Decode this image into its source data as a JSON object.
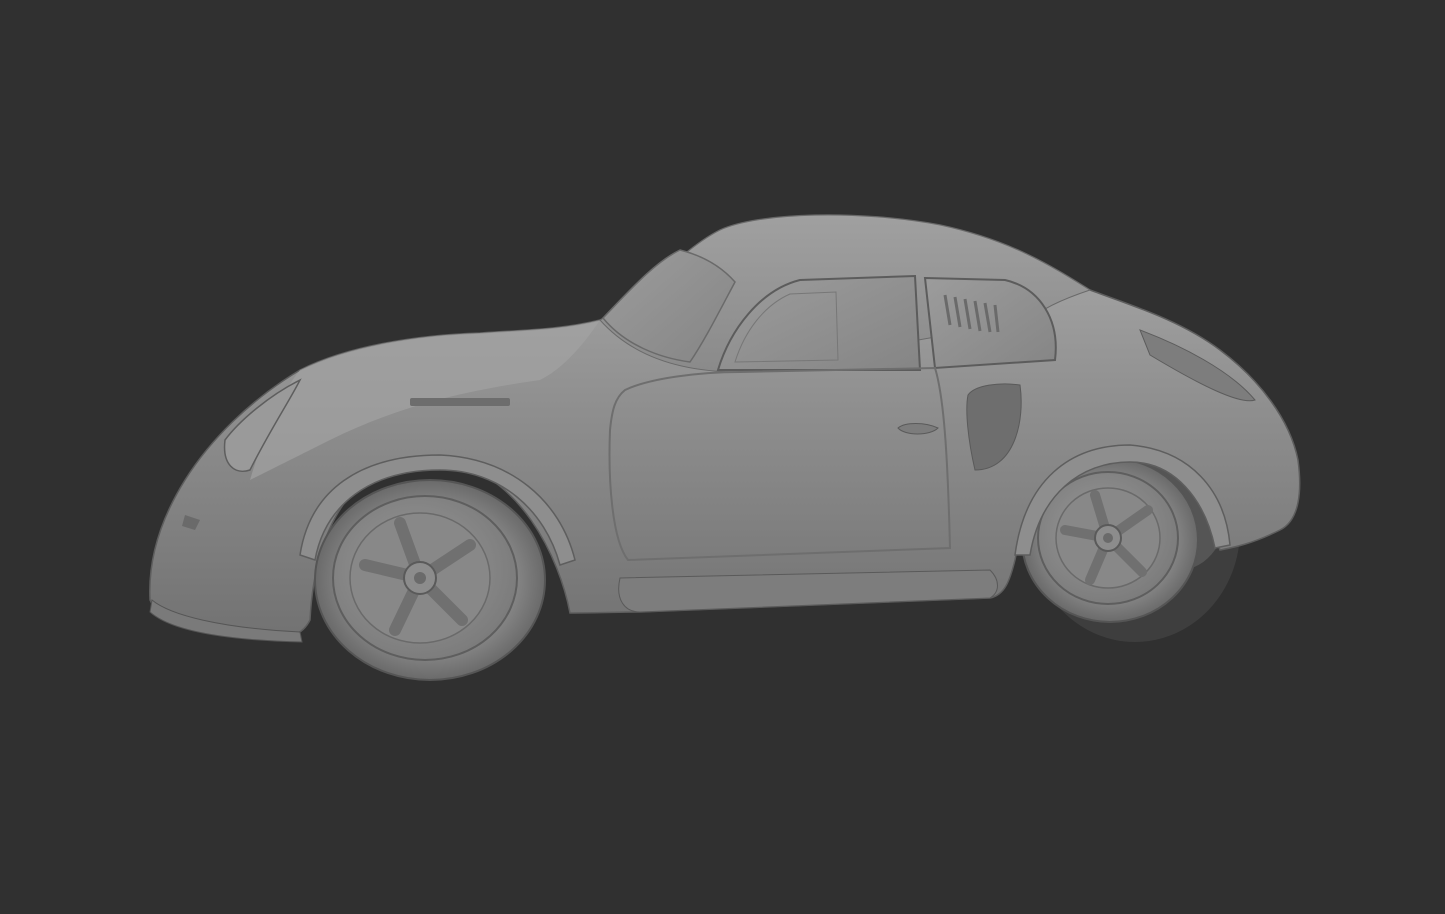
{
  "viewport": {
    "background_color": "#303030",
    "shading": "solid",
    "model": {
      "kind": "car",
      "body_color": "#8e8e8e",
      "highlight_color": "#b4b4b4",
      "shadow_color": "#5a5a5a",
      "icon": "car-icon"
    }
  }
}
